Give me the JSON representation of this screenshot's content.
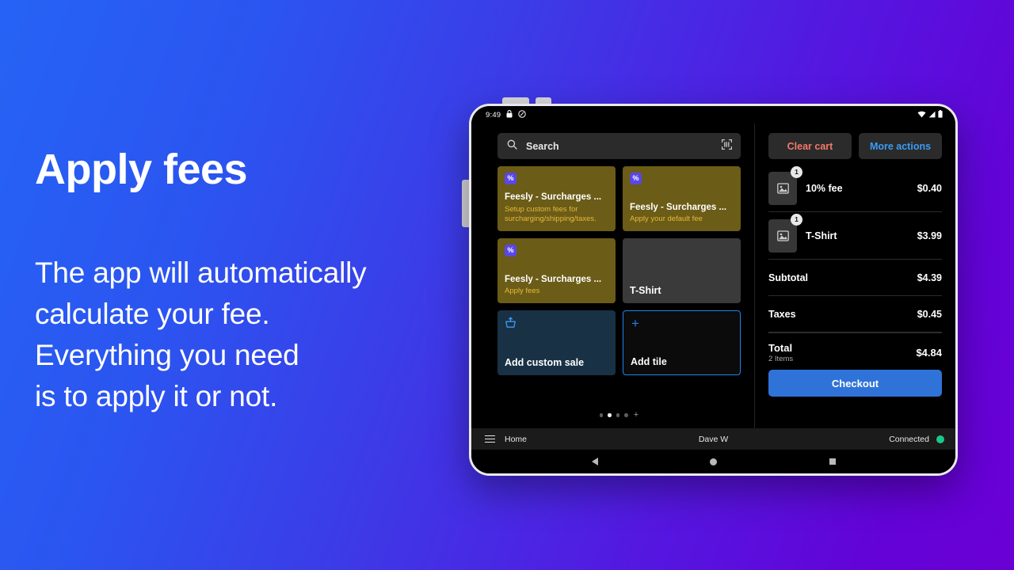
{
  "marketing": {
    "title": "Apply fees",
    "body": "The app will automatically calculate your fee. Everything you need is to apply it or not.",
    "body_lines": [
      "The app will automatically",
      "calculate your fee.",
      "Everything you need",
      "is to apply it or not."
    ]
  },
  "device": {
    "status_bar": {
      "time": "9:49",
      "left_icons": [
        "lock-icon",
        "do-not-disturb-icon"
      ],
      "right_icons": [
        "wifi-icon",
        "signal-icon",
        "battery-icon"
      ]
    },
    "nav_bar": {
      "back": "back-icon",
      "home": "home-icon",
      "recents": "recents-icon"
    }
  },
  "catalog": {
    "search": {
      "placeholder": "Search",
      "value": "",
      "icon": "search-icon",
      "scan_icon": "barcode-scan-icon"
    },
    "tiles": [
      {
        "title": "Feesly - Surcharges ...",
        "subtitle": "Setup custom fees for surcharging/shipping/taxes.",
        "icon": "percent-icon",
        "style": "olive"
      },
      {
        "title": "Feesly - Surcharges ...",
        "subtitle": "Apply your default fee",
        "icon": "percent-icon",
        "style": "olive"
      },
      {
        "title": "Feesly - Surcharges ...",
        "subtitle": "Apply fees",
        "icon": "percent-icon",
        "style": "olive"
      },
      {
        "title": "T-Shirt",
        "subtitle": "",
        "icon": "",
        "style": "grey"
      },
      {
        "title": "Add custom sale",
        "subtitle": "",
        "icon": "add-to-cart-icon",
        "style": "blue"
      },
      {
        "title": "Add tile",
        "subtitle": "",
        "icon": "plus-icon",
        "style": "add"
      }
    ],
    "pagination": {
      "pages": 4,
      "active_index": 1,
      "add_page_icon": "plus-icon"
    }
  },
  "cart": {
    "actions": {
      "clear_label": "Clear cart",
      "clear_color": "#f4786b",
      "more_label": "More actions",
      "more_color": "#3b9cf5"
    },
    "items": [
      {
        "name": "10% fee",
        "price": "$0.40",
        "qty": "1",
        "thumb_icon": "image-placeholder-icon"
      },
      {
        "name": "T-Shirt",
        "price": "$3.99",
        "qty": "1",
        "thumb_icon": "image-placeholder-icon"
      }
    ],
    "summary": [
      {
        "label": "Subtotal",
        "value": "$4.39"
      },
      {
        "label": "Taxes",
        "value": "$0.45"
      }
    ],
    "total": {
      "label": "Total",
      "count": "2 Items",
      "amount": "$4.84"
    },
    "checkout_label": "Checkout",
    "checkout_color": "#2f73d8"
  },
  "bottom_bar": {
    "menu_icon": "hamburger-menu-icon",
    "home_label": "Home",
    "user_label": "Dave W",
    "status_label": "Connected",
    "status_color": "#19c98a"
  }
}
